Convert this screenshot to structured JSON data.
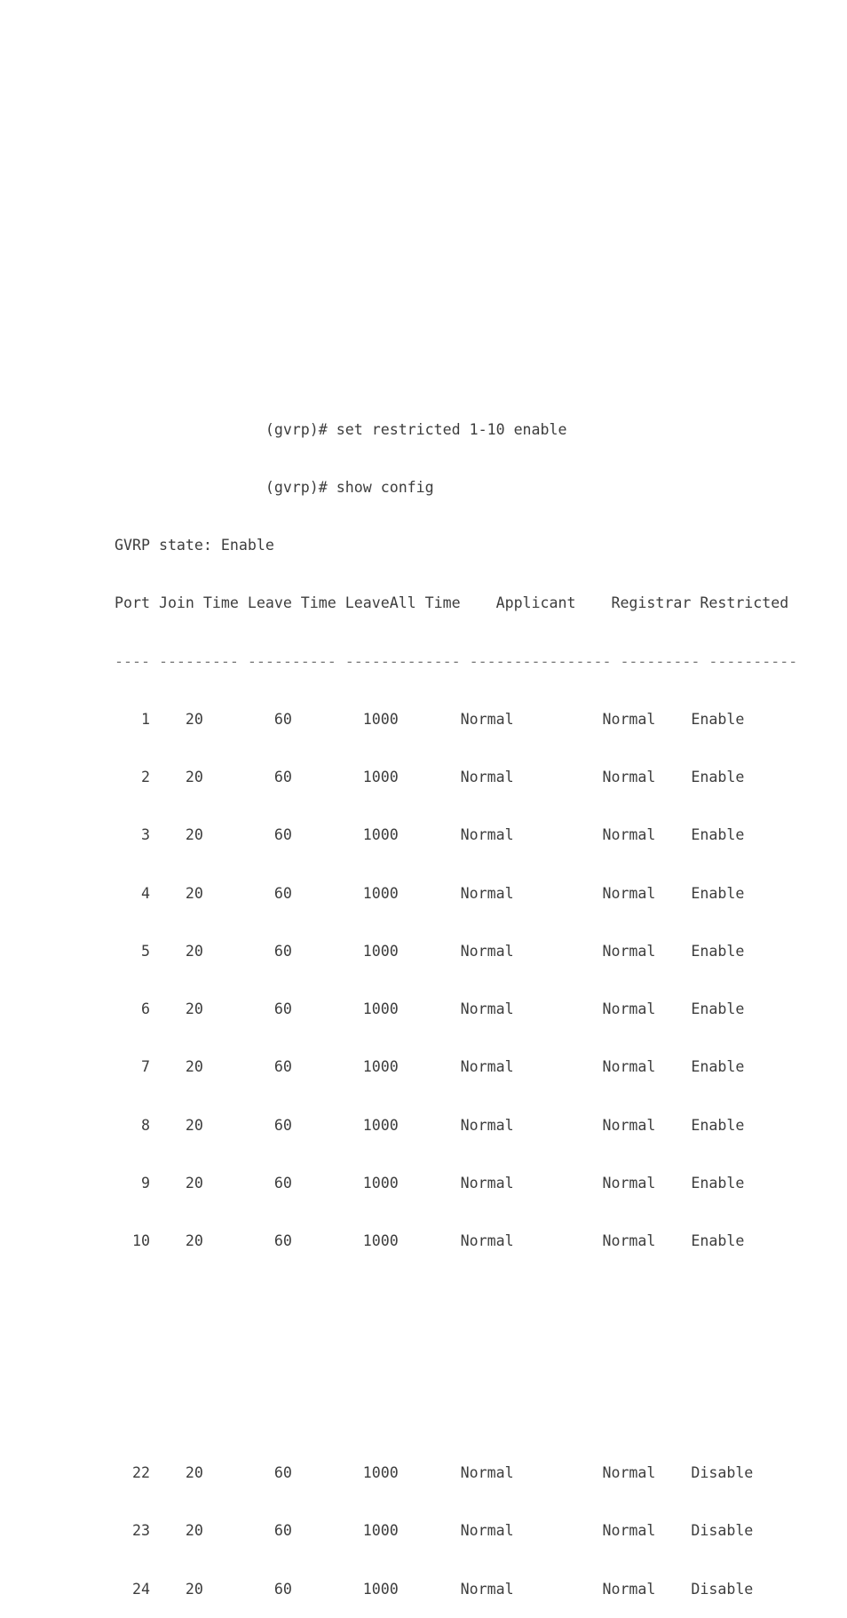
{
  "terminal": {
    "prompt": "(gvrp)#",
    "command_indent": 17,
    "commands": [
      {
        "prompt": "(gvrp)#",
        "text": "set restricted 1-10 enable",
        "full": "                 (gvrp)# set restricted 1-10 enable"
      },
      {
        "prompt": "(gvrp)#",
        "text": "show config",
        "full": "                 (gvrp)# show config"
      }
    ],
    "state_line": "GVRP state: Enable",
    "state_label": "GVRP state:",
    "state_value": "Enable",
    "header_line": "Port Join Time Leave Time LeaveAll Time    Applicant    Registrar Restricted",
    "separator_line": "---- --------- ---------- ------------- ---------------- --------- ----------",
    "columns": [
      {
        "label": "Port",
        "width": 4,
        "align": "right"
      },
      {
        "label": "Join Time",
        "width": 9,
        "align": "center"
      },
      {
        "label": "Leave Time",
        "width": 10,
        "align": "center"
      },
      {
        "label": "LeaveAll Time",
        "width": 13,
        "align": "center"
      },
      {
        "label": "Applicant",
        "width": 16,
        "align": "center"
      },
      {
        "label": "Registrar",
        "width": 9,
        "align": "left"
      },
      {
        "label": "Restricted",
        "width": 10,
        "align": "left"
      }
    ],
    "rows": [
      {
        "port": "1",
        "join_time": "20",
        "leave_time": "60",
        "leaveall_time": "1000",
        "applicant": "Normal",
        "registrar": "Normal",
        "restricted": "Enable",
        "text": "   1    20        60        1000       Normal          Normal    Enable"
      },
      {
        "port": "2",
        "join_time": "20",
        "leave_time": "60",
        "leaveall_time": "1000",
        "applicant": "Normal",
        "registrar": "Normal",
        "restricted": "Enable",
        "text": "   2    20        60        1000       Normal          Normal    Enable"
      },
      {
        "port": "3",
        "join_time": "20",
        "leave_time": "60",
        "leaveall_time": "1000",
        "applicant": "Normal",
        "registrar": "Normal",
        "restricted": "Enable",
        "text": "   3    20        60        1000       Normal          Normal    Enable"
      },
      {
        "port": "4",
        "join_time": "20",
        "leave_time": "60",
        "leaveall_time": "1000",
        "applicant": "Normal",
        "registrar": "Normal",
        "restricted": "Enable",
        "text": "   4    20        60        1000       Normal          Normal    Enable"
      },
      {
        "port": "5",
        "join_time": "20",
        "leave_time": "60",
        "leaveall_time": "1000",
        "applicant": "Normal",
        "registrar": "Normal",
        "restricted": "Enable",
        "text": "   5    20        60        1000       Normal          Normal    Enable"
      },
      {
        "port": "6",
        "join_time": "20",
        "leave_time": "60",
        "leaveall_time": "1000",
        "applicant": "Normal",
        "registrar": "Normal",
        "restricted": "Enable",
        "text": "   6    20        60        1000       Normal          Normal    Enable"
      },
      {
        "port": "7",
        "join_time": "20",
        "leave_time": "60",
        "leaveall_time": "1000",
        "applicant": "Normal",
        "registrar": "Normal",
        "restricted": "Enable",
        "text": "   7    20        60        1000       Normal          Normal    Enable"
      },
      {
        "port": "8",
        "join_time": "20",
        "leave_time": "60",
        "leaveall_time": "1000",
        "applicant": "Normal",
        "registrar": "Normal",
        "restricted": "Enable",
        "text": "   8    20        60        1000       Normal          Normal    Enable"
      },
      {
        "port": "9",
        "join_time": "20",
        "leave_time": "60",
        "leaveall_time": "1000",
        "applicant": "Normal",
        "registrar": "Normal",
        "restricted": "Enable",
        "text": "   9    20        60        1000       Normal          Normal    Enable"
      },
      {
        "port": "10",
        "join_time": "20",
        "leave_time": "60",
        "leaveall_time": "1000",
        "applicant": "Normal",
        "registrar": "Normal",
        "restricted": "Enable",
        "text": "  10    20        60        1000       Normal          Normal    Enable"
      }
    ],
    "gap_lines": 2,
    "rows_continued": [
      {
        "port": "22",
        "join_time": "20",
        "leave_time": "60",
        "leaveall_time": "1000",
        "applicant": "Normal",
        "registrar": "Normal",
        "restricted": "Disable",
        "text": "  22    20        60        1000       Normal          Normal    Disable"
      },
      {
        "port": "23",
        "join_time": "20",
        "leave_time": "60",
        "leaveall_time": "1000",
        "applicant": "Normal",
        "registrar": "Normal",
        "restricted": "Disable",
        "text": "  23    20        60        1000       Normal          Normal    Disable"
      },
      {
        "port": "24",
        "join_time": "20",
        "leave_time": "60",
        "leaveall_time": "1000",
        "applicant": "Normal",
        "registrar": "Normal",
        "restricted": "Disable",
        "text": "  24    20        60        1000       Normal          Normal    Disable"
      }
    ]
  },
  "colors": {
    "text": "#3d3d3d",
    "separator": "#7a7a7a",
    "background": "#ffffff"
  }
}
